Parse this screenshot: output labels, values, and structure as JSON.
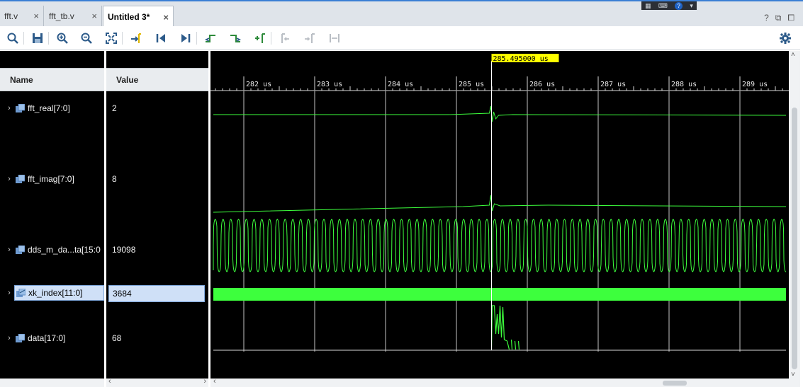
{
  "tabs": [
    {
      "label": "fft.v",
      "close": "×"
    },
    {
      "label": "fft_tb.v",
      "close": "×"
    },
    {
      "label": "Untitled 3*",
      "close": "×",
      "active": true
    }
  ],
  "window_controls": [
    "?",
    "⧉",
    "⧠"
  ],
  "toolbar": {
    "icons": [
      "search-icon",
      "save-icon",
      "zoom-in-icon",
      "zoom-out-icon",
      "zoom-fit-icon",
      "go-to-cursor-icon",
      "go-to-start-icon",
      "go-to-end-icon",
      "previous-transition-icon",
      "next-transition-icon",
      "add-marker-icon",
      "previous-marker-icon",
      "next-marker-icon",
      "swap-cursors-icon",
      "settings-gear-icon"
    ]
  },
  "columns": {
    "name": "Name",
    "value": "Value"
  },
  "signals": [
    {
      "name": "fft_real[7:0]",
      "value": "2",
      "type": "analog",
      "expander": "›"
    },
    {
      "name": "fft_imag[7:0]",
      "value": "8",
      "type": "analog",
      "expander": "›"
    },
    {
      "name": "dds_m_da...ta[15:0",
      "value": "19098",
      "type": "analog",
      "expander": "›"
    },
    {
      "name": "xk_index[11:0]",
      "value": "3684",
      "type": "bus",
      "expander": "›",
      "selected": true
    },
    {
      "name": "data[17:0]",
      "value": "68",
      "type": "analog",
      "expander": "›"
    }
  ],
  "cursor": {
    "label": "285.495000 us",
    "time_us": 285.495
  },
  "timeline": {
    "start_us": 281.57,
    "end_us": 289.65,
    "ticks": [
      "282 us",
      "283 us",
      "284 us",
      "285 us",
      "286 us",
      "287 us",
      "288 us",
      "289 us"
    ],
    "tick_values_us": [
      282,
      283,
      284,
      285,
      286,
      287,
      288,
      289
    ]
  },
  "colors": {
    "wave": "#3dff3d",
    "cursor_label_bg": "#ffff00",
    "grid": "#d9d9d9",
    "background": "#000000",
    "accent": "#3b7fd4"
  },
  "scroll_arrows": {
    "left": "‹",
    "right": "›",
    "up": "˄",
    "down": "˅"
  }
}
